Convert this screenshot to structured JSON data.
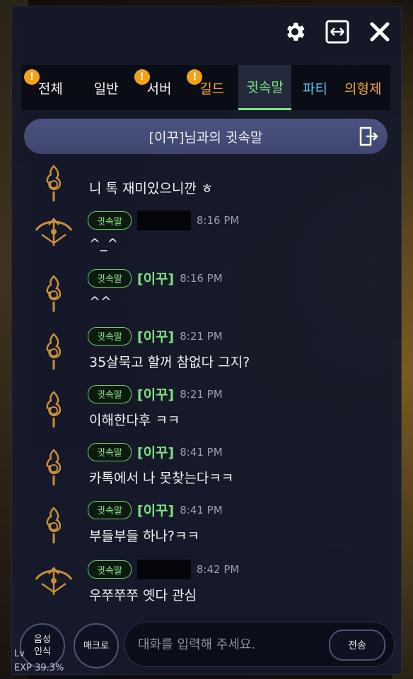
{
  "tabs": [
    {
      "label": "전체",
      "badge": "!"
    },
    {
      "label": "일반"
    },
    {
      "label": "서버",
      "badge": "!"
    },
    {
      "label": "길드",
      "badge": "!"
    },
    {
      "label": "귓속말"
    },
    {
      "label": "파티"
    },
    {
      "label": "의형제"
    }
  ],
  "active_tab": "귓속말",
  "header": {
    "title": "[이꾸]님과의 귓속말"
  },
  "whisper_chip": "귓속말",
  "messages": [
    {
      "sender": "",
      "time": "",
      "text": "니 톡 재미있으니깐 ㅎ",
      "avatar": "flame-emblem"
    },
    {
      "sender": "",
      "time": "8:16 PM",
      "text": "^_^",
      "avatar": "bow-emblem"
    },
    {
      "sender": "[이꾸]",
      "time": "8:16 PM",
      "text": "^^",
      "avatar": "flame-emblem"
    },
    {
      "sender": "[이꾸]",
      "time": "8:21 PM",
      "text": "35살묵고 할꺼 참없다 그지?",
      "avatar": "flame-emblem"
    },
    {
      "sender": "[이꾸]",
      "time": "8:21 PM",
      "text": "이해한다후 ㅋㅋ",
      "avatar": "flame-emblem"
    },
    {
      "sender": "[이꾸]",
      "time": "8:41 PM",
      "text": "카톡에서 나 못찾는다ㅋㅋ",
      "avatar": "flame-emblem"
    },
    {
      "sender": "[이꾸]",
      "time": "8:41 PM",
      "text": "부들부들 하나?ㅋㅋ",
      "avatar": "flame-emblem"
    },
    {
      "sender": "",
      "time": "8:42 PM",
      "text": "우쭈쭈쭈 옛다 관심",
      "avatar": "bow-emblem"
    }
  ],
  "bottom": {
    "voice_label_1": "음성",
    "voice_label_2": "인식",
    "macro_label": "매크로",
    "input_placeholder": "대화를 입력해 주세요.",
    "send_label": "전송"
  },
  "hud": {
    "lv_text": "Lv",
    "exp_text": "EXP 39.3%"
  },
  "icons": [
    "gear-icon",
    "resize-icon",
    "close-icon",
    "exit-door-icon"
  ],
  "colors": {
    "accent_green": "#7fe27f",
    "badge_orange": "#f2a21a",
    "header_blue": "#4a5380"
  }
}
